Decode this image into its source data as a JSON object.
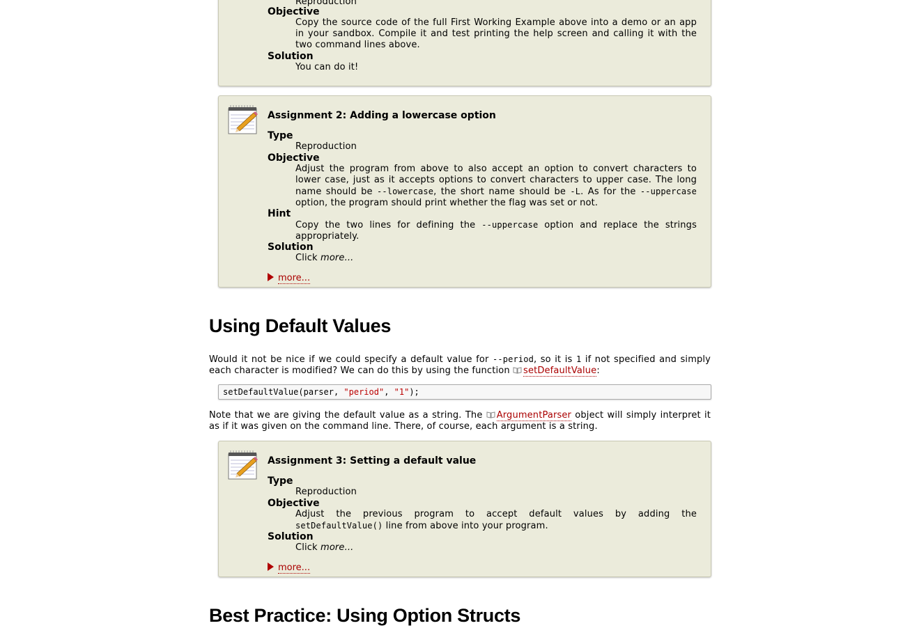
{
  "box1": {
    "type_value": "Reproduction",
    "objective_term": "Objective",
    "objective_text": "Copy the source code of the full First Working Example above into a demo or an app in your sandbox. Compile it and test printing the help screen and calling it with the two command lines above.",
    "solution_term": "Solution",
    "solution_text": "You can do it!"
  },
  "box2": {
    "title": "Assignment 2: Adding a lowercase option",
    "type_term": "Type",
    "type_value": "Reproduction",
    "objective_term": "Objective",
    "objective_p1": "Adjust the program from above to also accept an option to convert characters to lower case, just as it accepts options to convert characters to upper case. The long name should be ",
    "objective_code1": "--lowercase",
    "objective_p2": ", the short name should be ",
    "objective_code2": "-L",
    "objective_p3": ". As for the ",
    "objective_code3": "--uppercase",
    "objective_p4": " option, the program should print whether the flag was set or not.",
    "hint_term": "Hint",
    "hint_p1": "Copy the two lines for defining the ",
    "hint_code": "--uppercase",
    "hint_p2": " option and replace the strings appropriately.",
    "solution_term": "Solution",
    "solution_click": "Click ",
    "solution_more": "more...",
    "more_link": "more..."
  },
  "section1": {
    "heading": "Using Default Values",
    "para1_a": "Would it not be nice if we could specify a default value for ",
    "para1_code1": "--period",
    "para1_b": ", so it is ",
    "para1_code2": "1",
    "para1_c": " if not specified and simply each character is modified? We can do this by using the function ",
    "para1_link": "setDefaultValue",
    "para1_d": ":",
    "code_fn": "setDefaultValue(parser, ",
    "code_str1": "\"period\"",
    "code_sep": ", ",
    "code_str2": "\"1\"",
    "code_end": ");",
    "para2_a": "Note that we are giving the default value as a string. The ",
    "para2_link": "ArgumentParser",
    "para2_b": " object will simply interpret it as if it was given on the command line. There, of course, each argument is a string."
  },
  "box3": {
    "title": "Assignment 3: Setting a default value",
    "type_term": "Type",
    "type_value": "Reproduction",
    "objective_term": "Objective",
    "objective_p1": "Adjust the previous program to accept default values by adding the ",
    "objective_code": "setDefaultValue()",
    "objective_p2": " line from above into your program.",
    "solution_term": "Solution",
    "solution_click": "Click ",
    "solution_more": "more...",
    "more_link": "more..."
  },
  "section2": {
    "heading": "Best Practice: Using Option Structs"
  },
  "icons": {
    "assignment": "notepad-pencil-icon",
    "doc_link": "book-icon",
    "expand": "triangle-right-icon"
  }
}
